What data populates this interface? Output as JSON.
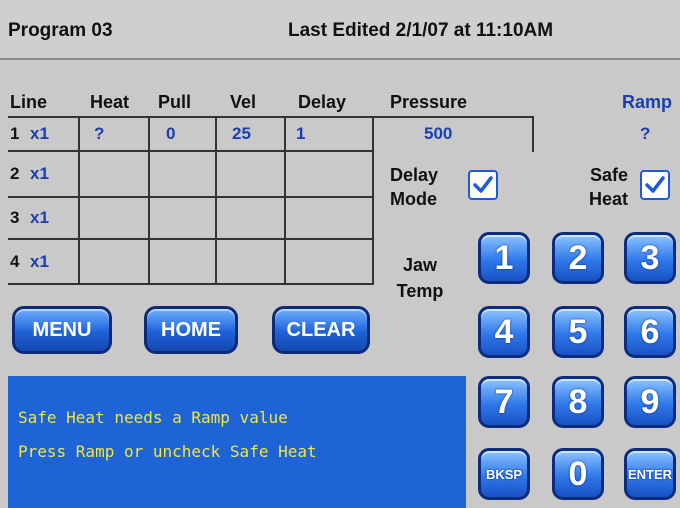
{
  "header": {
    "program": "Program 03",
    "last_edited": "Last Edited 2/1/07 at 11:10AM"
  },
  "table": {
    "columns": [
      "Line",
      "Heat",
      "Pull",
      "Vel",
      "Delay",
      "Pressure"
    ],
    "ramp_label": "Ramp",
    "rows": [
      {
        "line": "1",
        "mult": "x1",
        "heat": "?",
        "pull": "0",
        "vel": "25",
        "delay": "1",
        "pressure": "500"
      },
      {
        "line": "2",
        "mult": "x1"
      },
      {
        "line": "3",
        "mult": "x1"
      },
      {
        "line": "4",
        "mult": "x1"
      }
    ],
    "ramp_value": "?"
  },
  "options": {
    "delay_mode_line1": "Delay",
    "delay_mode_line2": "Mode",
    "delay_mode_checked": true,
    "safe_heat_line1": "Safe",
    "safe_heat_line2": "Heat",
    "safe_heat_checked": true,
    "jaw_temp_line1": "Jaw",
    "jaw_temp_line2": "Temp"
  },
  "buttons": {
    "menu": "MENU",
    "home": "HOME",
    "clear": "CLEAR"
  },
  "keypad": {
    "k1": "1",
    "k2": "2",
    "k3": "3",
    "k4": "4",
    "k5": "5",
    "k6": "6",
    "k7": "7",
    "k8": "8",
    "k9": "9",
    "bksp": "BKSP",
    "k0": "0",
    "enter": "ENTER"
  },
  "message": {
    "line1": "Safe Heat needs a Ramp value",
    "line2": "Press Ramp or uncheck Safe Heat"
  },
  "colors": {
    "accent_blue": "#1f64d4",
    "message_text": "#f4e63a",
    "background": "#c9c9c9"
  },
  "icons": {
    "checkbox": "checkmark-icon"
  }
}
